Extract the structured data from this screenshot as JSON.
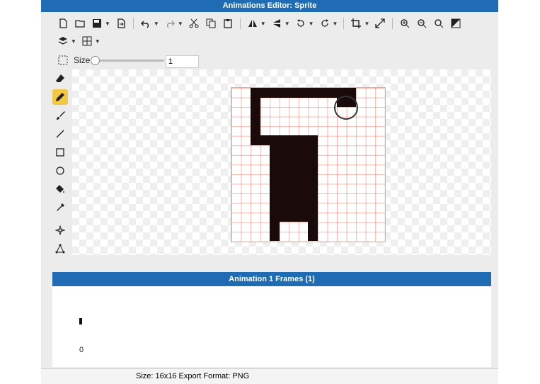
{
  "window": {
    "title": "Animations Editor: Sprite"
  },
  "toolbar": {
    "size_label": "Size",
    "size_value": "1"
  },
  "tools": [
    {
      "name": "eraser-icon"
    },
    {
      "name": "pencil-icon"
    },
    {
      "name": "brush-icon"
    },
    {
      "name": "line-icon"
    },
    {
      "name": "rectangle-icon"
    },
    {
      "name": "ellipse-icon"
    },
    {
      "name": "fill-bucket-icon"
    },
    {
      "name": "eyedropper-icon"
    },
    {
      "name": "move-point-icon"
    },
    {
      "name": "transform-icon"
    }
  ],
  "frames_panel": {
    "title": "Animation 1 Frames (1)",
    "frame_number": "0"
  },
  "status": {
    "text": "Size: 16x16   Export Format: PNG"
  },
  "colors": {
    "accent": "#1f6cb5",
    "pixel": "#1a0a0a",
    "active_tool": "#f2c744"
  }
}
